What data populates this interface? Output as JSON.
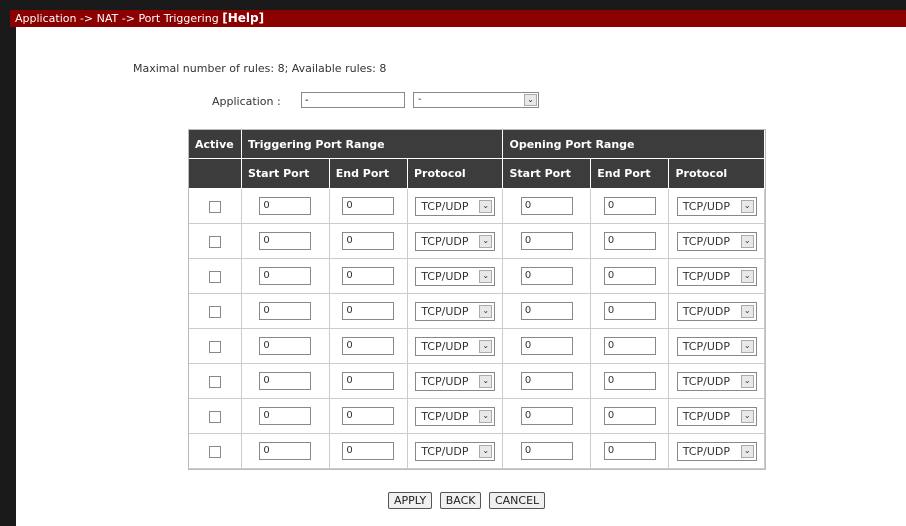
{
  "header": {
    "breadcrumb": "Application -> NAT -> Port Triggering",
    "help_label": "[Help]"
  },
  "info": {
    "rules_text": "Maximal number of rules: 8; Available rules: 8"
  },
  "application": {
    "label": "Application :",
    "input_value": "-",
    "select_value": "-"
  },
  "table": {
    "headers": {
      "active": "Active",
      "triggering": "Triggering Port Range",
      "opening": "Opening Port Range",
      "start_port": "Start Port",
      "end_port": "End Port",
      "protocol": "Protocol"
    },
    "rows": [
      {
        "active": false,
        "trig_start": "0",
        "trig_end": "0",
        "trig_proto": "TCP/UDP",
        "open_start": "0",
        "open_end": "0",
        "open_proto": "TCP/UDP"
      },
      {
        "active": false,
        "trig_start": "0",
        "trig_end": "0",
        "trig_proto": "TCP/UDP",
        "open_start": "0",
        "open_end": "0",
        "open_proto": "TCP/UDP"
      },
      {
        "active": false,
        "trig_start": "0",
        "trig_end": "0",
        "trig_proto": "TCP/UDP",
        "open_start": "0",
        "open_end": "0",
        "open_proto": "TCP/UDP"
      },
      {
        "active": false,
        "trig_start": "0",
        "trig_end": "0",
        "trig_proto": "TCP/UDP",
        "open_start": "0",
        "open_end": "0",
        "open_proto": "TCP/UDP"
      },
      {
        "active": false,
        "trig_start": "0",
        "trig_end": "0",
        "trig_proto": "TCP/UDP",
        "open_start": "0",
        "open_end": "0",
        "open_proto": "TCP/UDP"
      },
      {
        "active": false,
        "trig_start": "0",
        "trig_end": "0",
        "trig_proto": "TCP/UDP",
        "open_start": "0",
        "open_end": "0",
        "open_proto": "TCP/UDP"
      },
      {
        "active": false,
        "trig_start": "0",
        "trig_end": "0",
        "trig_proto": "TCP/UDP",
        "open_start": "0",
        "open_end": "0",
        "open_proto": "TCP/UDP"
      },
      {
        "active": false,
        "trig_start": "0",
        "trig_end": "0",
        "trig_proto": "TCP/UDP",
        "open_start": "0",
        "open_end": "0",
        "open_proto": "TCP/UDP"
      }
    ]
  },
  "buttons": {
    "apply": "APPLY",
    "back": "BACK",
    "cancel": "CANCEL"
  },
  "colors": {
    "header_bar": "#8b0000",
    "table_header": "#3c3c3c"
  },
  "icons": {
    "dropdown": "chevron-down-icon",
    "checkbox": "checkbox-icon"
  }
}
